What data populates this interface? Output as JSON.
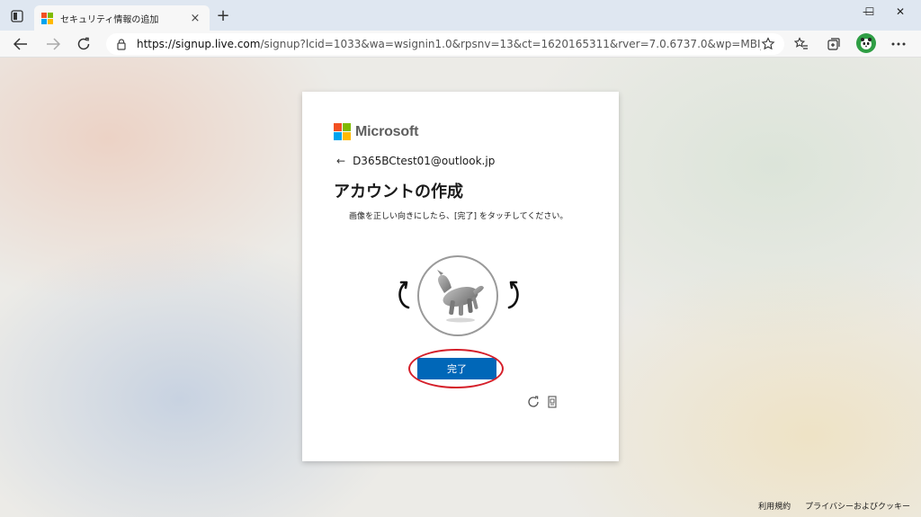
{
  "browser": {
    "tab_title": "セキュリティ情報の追加",
    "tab_close": "×",
    "new_tab": "+",
    "url_host": "https://signup.live.com",
    "url_rest": "/signup?lcid=1033&wa=wsignin1.0&rpsnv=13&ct=1620165311&rver=7.0.6737.0&wp=MBI_SSL...",
    "window_controls": {
      "minimize": "—",
      "maximize": "☐",
      "close": "✕"
    }
  },
  "card": {
    "brand": "Microsoft",
    "back_arrow": "←",
    "email": "D365BCtest01@outlook.jp",
    "heading": "アカウントの作成",
    "instruction": "画像を正しい向きにしたら、[完了] をタッチしてください。",
    "done_button": "完了"
  },
  "footer": {
    "terms": "利用規約",
    "privacy": "プライバシーおよびクッキー"
  },
  "colors": {
    "ms_red": "#f25022",
    "ms_green": "#7fba00",
    "ms_blue": "#00a4ef",
    "ms_yellow": "#ffb900",
    "primary_button": "#0067b8",
    "annotation": "#d51f2a"
  }
}
